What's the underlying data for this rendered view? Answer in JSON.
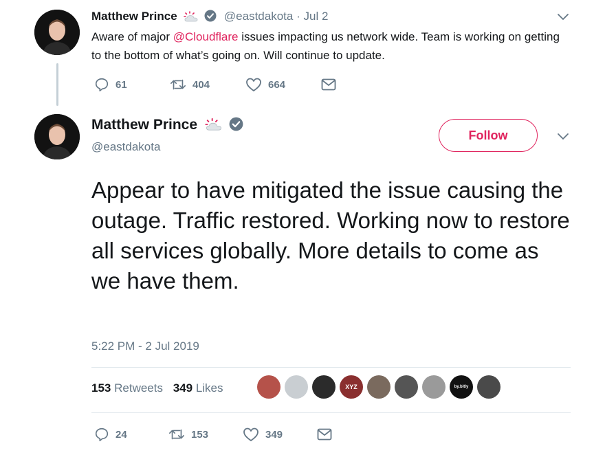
{
  "tweet1": {
    "name": "Matthew Prince",
    "handle": "@eastdakota",
    "separator": "·",
    "date": "Jul 2",
    "text_before": "Aware of major ",
    "mention": "@Cloudflare",
    "text_after": " issues impacting us network wide. Team is working on getting to the bottom of what’s going on. Will continue to update.",
    "replies": "61",
    "retweets": "404",
    "likes": "664"
  },
  "tweet2": {
    "name": "Matthew Prince",
    "handle": "@eastdakota",
    "follow_label": "Follow",
    "text": "Appear to have mitigated the issue causing the outage. Traffic restored. Working now to restore all services globally. More details to come as we have them.",
    "timestamp": "5:22 PM - 2 Jul 2019",
    "retweet_count": "153",
    "retweet_label": "Retweets",
    "like_count": "349",
    "like_label": "Likes",
    "likers": [
      {
        "label": "",
        "color": "#b5524a"
      },
      {
        "label": "",
        "color": "#c9ced2"
      },
      {
        "label": "",
        "color": "#2b2b2b"
      },
      {
        "label": "XYZ",
        "color": "#8a2f2f"
      },
      {
        "label": "",
        "color": "#7a6a5e"
      },
      {
        "label": "",
        "color": "#555555"
      },
      {
        "label": "",
        "color": "#9a9a9a"
      },
      {
        "label": "by.bitly",
        "color": "#111111"
      },
      {
        "label": "",
        "color": "#4a4a4a"
      }
    ],
    "replies": "24",
    "retweets": "153",
    "likes": "349"
  },
  "colors": {
    "accent": "#e0245e",
    "muted": "#657786",
    "text": "#14171a",
    "divider": "#e1e8ed"
  }
}
